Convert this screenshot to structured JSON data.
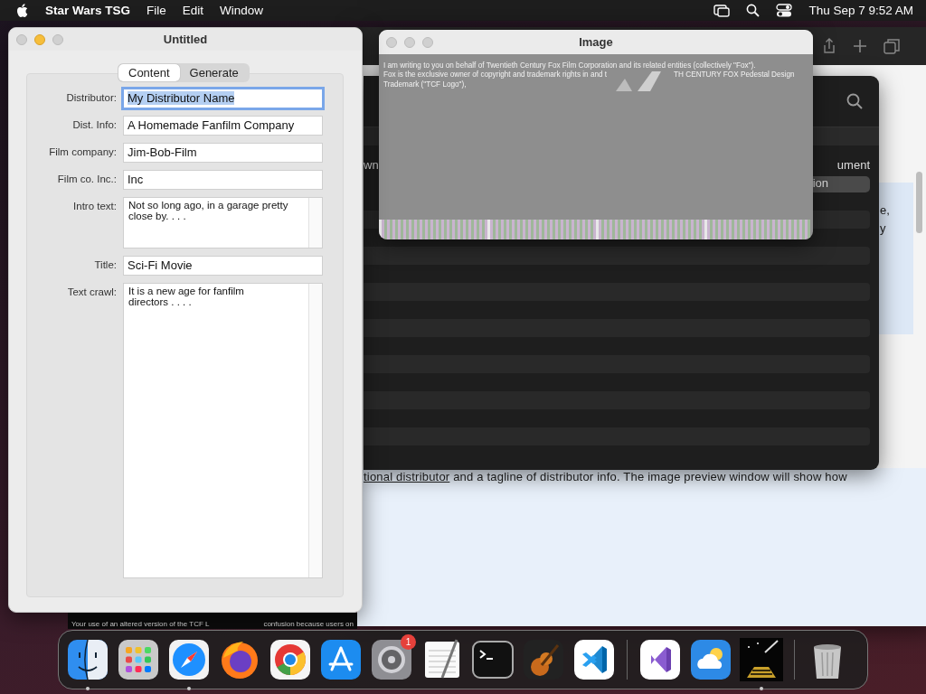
{
  "menu_bar": {
    "app_name": "Star Wars TSG",
    "menus": [
      "File",
      "Edit",
      "Window"
    ],
    "clock": "Thu Sep 7  9:52 AM"
  },
  "browser_window": {
    "link": "tional distributor",
    "paragraph": " and a tagline of distributor info. The image preview window will show how",
    "side_fragments": [
      "e,",
      "y"
    ]
  },
  "dark_window": {
    "column_1": "wn",
    "column_2": "ument",
    "button_text": "ion"
  },
  "background_strip": {
    "lines": [
      "Your use of an altered version of the TCF L",
      "confusion because users on"
    ]
  },
  "editor_window": {
    "title": "Untitled",
    "tabs": [
      {
        "label": "Content",
        "selected": true
      },
      {
        "label": "Generate",
        "selected": false
      }
    ],
    "fields": [
      {
        "kind": "line",
        "label": "Distributor:",
        "value": "My Distributor Name",
        "focused": true
      },
      {
        "kind": "line",
        "label": "Dist. Info:",
        "value": "A Homemade Fanfilm Company",
        "focused": false
      },
      {
        "kind": "line",
        "label": "Film company:",
        "value": "Jim-Bob-Film",
        "focused": false
      },
      {
        "kind": "line",
        "label": "Film co. Inc.:",
        "value": "Inc",
        "focused": false
      },
      {
        "kind": "area",
        "label": "Intro text:",
        "value": "Not so long ago, in a garage pretty close by. . . .",
        "focused": false
      },
      {
        "kind": "line",
        "label": "Title:",
        "value": "Sci-Fi Movie",
        "focused": false
      },
      {
        "kind": "tall",
        "label": "Text crawl:",
        "value": "It is a new age for fanfilm\ndirectors . . . .",
        "focused": false
      }
    ]
  },
  "image_window": {
    "title": "Image",
    "lines": [
      {
        "parts": [
          "I am writing to you on behalf of Twentieth Century Fox Film Corporation and its related entities (collectively \"Fox\")."
        ]
      },
      {
        "parts": [
          "Fox is the exclusive owner of copyright and trademark rights in and t",
          "TH CENTURY FOX Pedestal Design"
        ]
      },
      {
        "parts": [
          "Trademark (\"TCF Logo\"),"
        ]
      }
    ]
  },
  "dock": {
    "apps": [
      {
        "kind": "finder",
        "running": true
      },
      {
        "kind": "launchpad",
        "running": false
      },
      {
        "kind": "safari",
        "running": true
      },
      {
        "kind": "firefox",
        "running": false
      },
      {
        "kind": "chrome",
        "running": false
      },
      {
        "kind": "appstore",
        "running": false
      },
      {
        "kind": "settings",
        "running": false,
        "badge": "1"
      },
      {
        "kind": "textedit",
        "running": false
      },
      {
        "kind": "terminal",
        "running": false
      },
      {
        "kind": "guitar",
        "running": false
      },
      {
        "kind": "vscode",
        "running": false
      },
      {
        "kind": "separator"
      },
      {
        "kind": "studio",
        "running": false
      },
      {
        "kind": "weather",
        "running": false
      },
      {
        "kind": "starwars",
        "running": true
      },
      {
        "kind": "separator"
      },
      {
        "kind": "trash",
        "running": false
      }
    ]
  }
}
